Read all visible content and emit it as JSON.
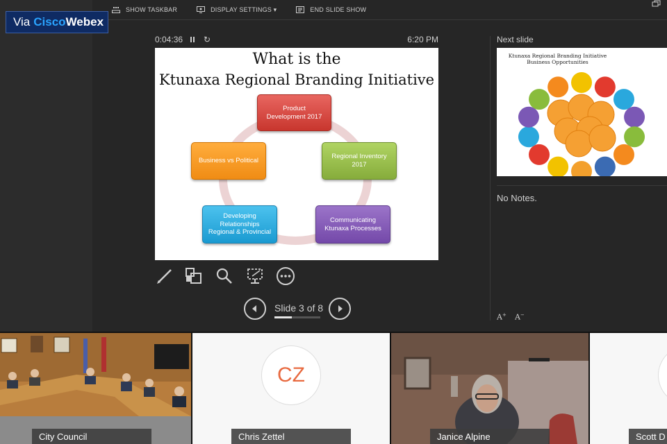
{
  "brand": {
    "prefix": "Via",
    "name_part1": "Cisco",
    "name_part2": "Webex"
  },
  "toolbar": {
    "show_taskbar": "SHOW TASKBAR",
    "display_settings": "DISPLAY SETTINGS ▾",
    "end_slide_show": "END SLIDE SHOW"
  },
  "presenter": {
    "elapsed": "0:04:36",
    "clock": "6:20 PM",
    "slide": {
      "title_line1": "What is the",
      "title_line2": "Ktunaxa Regional Branding Initiative",
      "boxes": {
        "product_line1": "Product",
        "product_line2": "Development 2017",
        "inventory_line1": "Regional Inventory",
        "inventory_line2": "2017",
        "business": "Business vs Political",
        "relationships_line1": "Developing",
        "relationships_line2": "Relationships",
        "relationships_line3": "Regional & Provincial",
        "communicating_line1": "Communicating",
        "communicating_line2": "Ktunaxa Processes"
      },
      "colors": {
        "red": "#d2443c",
        "green": "#99bf4a",
        "orange": "#f89a20",
        "blue": "#2aaade",
        "purple": "#8057b5",
        "ring": "#ecd3d4"
      }
    },
    "navigation": {
      "slide_label": "Slide 3 of 8",
      "current": 3,
      "total": 8
    },
    "tools": [
      "pen-icon",
      "annotation-layers-icon",
      "zoom-icon",
      "black-screen-icon",
      "more-icon"
    ]
  },
  "next_slide": {
    "label": "Next slide",
    "title_line1": "Ktunaxa Regional Branding Initiative",
    "title_line2": "Business Opportunities",
    "bubble_colors": [
      "#f2c200",
      "#e23a2e",
      "#2aa8dd",
      "#7b58b5",
      "#89bc3c",
      "#f48a1e",
      "#3b6bb3",
      "#f3a02d"
    ]
  },
  "notes": {
    "text": "No Notes."
  },
  "participants": [
    {
      "name": "City Council"
    },
    {
      "name": "Chris Zettel",
      "initials": "CZ"
    },
    {
      "name": "Janice Alpine"
    },
    {
      "name": "Scott D"
    }
  ]
}
